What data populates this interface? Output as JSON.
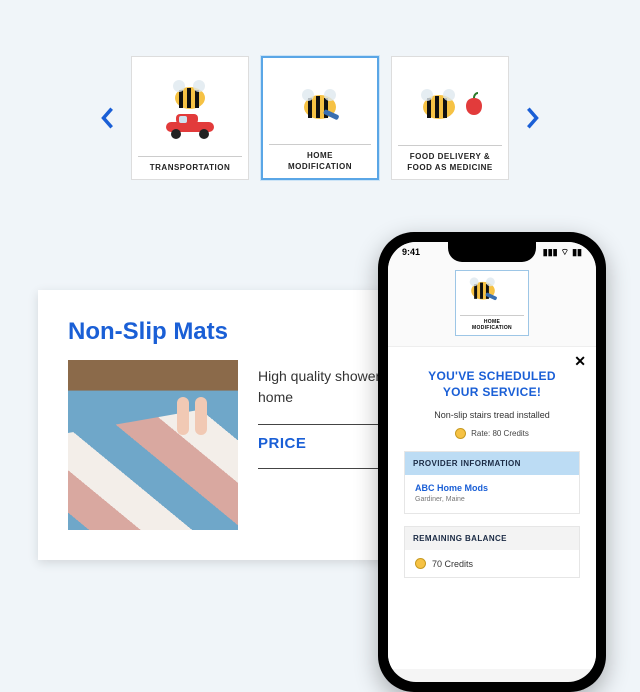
{
  "carousel": {
    "items": [
      {
        "label": "TRANSPORTATION",
        "icon": "bee-car"
      },
      {
        "label": "HOME\nMODIFICATION",
        "icon": "bee-hammer"
      },
      {
        "label": "FOOD DELIVERY &\nFOOD AS MEDICINE",
        "icon": "bee-apple"
      }
    ],
    "selected_index": 1
  },
  "product": {
    "title": "Non-Slip Mats",
    "description": "High quality shower mats for your home",
    "price_label": "PRICE"
  },
  "phone": {
    "status_time": "9:41",
    "header_card_label": "HOME\nMODIFICATION",
    "scheduled_title": "YOU'VE SCHEDULED\nYOUR SERVICE!",
    "scheduled_subtitle": "Non-slip stairs tread installed",
    "rate_text": "Rate: 80 Credits",
    "provider_section_title": "PROVIDER INFORMATION",
    "provider_name": "ABC Home Mods",
    "provider_location": "Gardiner, Maine",
    "balance_section_title": "REMAINING BALANCE",
    "balance_text": "70 Credits"
  }
}
